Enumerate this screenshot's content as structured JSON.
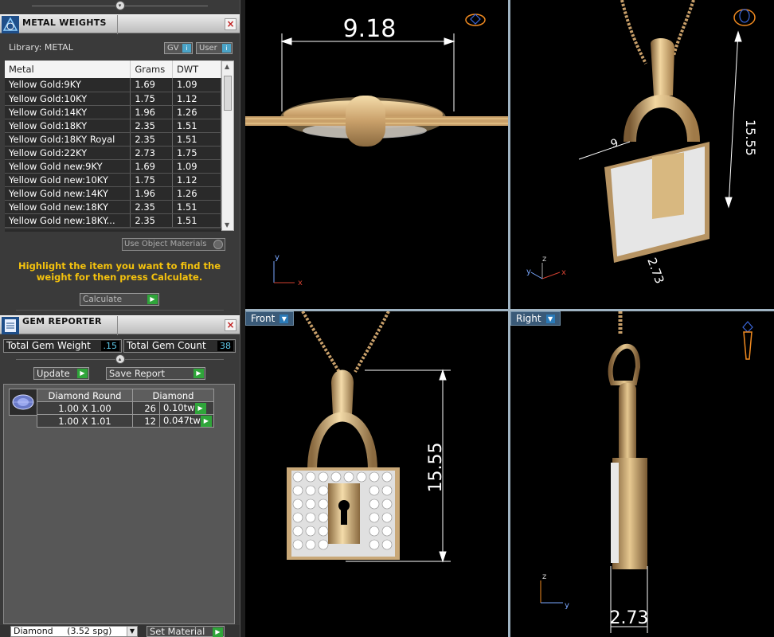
{
  "metal_panel": {
    "title": "METAL WEIGHTS",
    "library_label": "Library: METAL",
    "gv_label": "GV",
    "user_label": "User",
    "columns": [
      "Metal",
      "Grams",
      "DWT"
    ],
    "rows": [
      {
        "metal": "Yellow Gold:9KY",
        "grams": "1.69",
        "dwt": "1.09"
      },
      {
        "metal": "Yellow Gold:10KY",
        "grams": "1.75",
        "dwt": "1.12"
      },
      {
        "metal": "Yellow Gold:14KY",
        "grams": "1.96",
        "dwt": "1.26"
      },
      {
        "metal": "Yellow Gold:18KY",
        "grams": "2.35",
        "dwt": "1.51"
      },
      {
        "metal": "Yellow Gold:18KY Royal",
        "grams": "2.35",
        "dwt": "1.51"
      },
      {
        "metal": "Yellow Gold:22KY",
        "grams": "2.73",
        "dwt": "1.75"
      },
      {
        "metal": "Yellow Gold new:9KY",
        "grams": "1.69",
        "dwt": "1.09"
      },
      {
        "metal": "Yellow Gold new:10KY",
        "grams": "1.75",
        "dwt": "1.12"
      },
      {
        "metal": "Yellow Gold new:14KY",
        "grams": "1.96",
        "dwt": "1.26"
      },
      {
        "metal": "Yellow Gold new:18KY",
        "grams": "2.35",
        "dwt": "1.51"
      },
      {
        "metal": "Yellow Gold new:18KY...",
        "grams": "2.35",
        "dwt": "1.51"
      }
    ],
    "use_object_materials": "Use Object Materials",
    "hint": "Highlight the item you want to find the weight for then press Calculate.",
    "calculate_label": "Calculate"
  },
  "gem_panel": {
    "title": "GEM REPORTER",
    "total_weight_label": "Total Gem Weight",
    "total_weight_value": ".15",
    "total_count_label": "Total Gem Count",
    "total_count_value": "38",
    "update_label": "Update",
    "save_report_label": "Save Report",
    "header_shape": "Diamond Round",
    "header_material": "Diamond",
    "gems": [
      {
        "size": "1.00 X 1.00",
        "count": "26",
        "weight": "0.10tw"
      },
      {
        "size": "1.00 X 1.01",
        "count": "12",
        "weight": "0.047tw"
      }
    ]
  },
  "bottom": {
    "material_select": "Diamond     (3.52 spg)",
    "set_material_label": "Set Material"
  },
  "viewports": {
    "front_label": "Front",
    "right_label": "Right",
    "top_dim": "9.18",
    "persp_height_dim": "15.55",
    "persp_width_dim": "9",
    "persp_depth_dim": "2.73",
    "front_height_dim": "15.55",
    "right_depth_dim": "2.73",
    "axis_x": "x",
    "axis_y": "y",
    "axis_z": "z"
  }
}
